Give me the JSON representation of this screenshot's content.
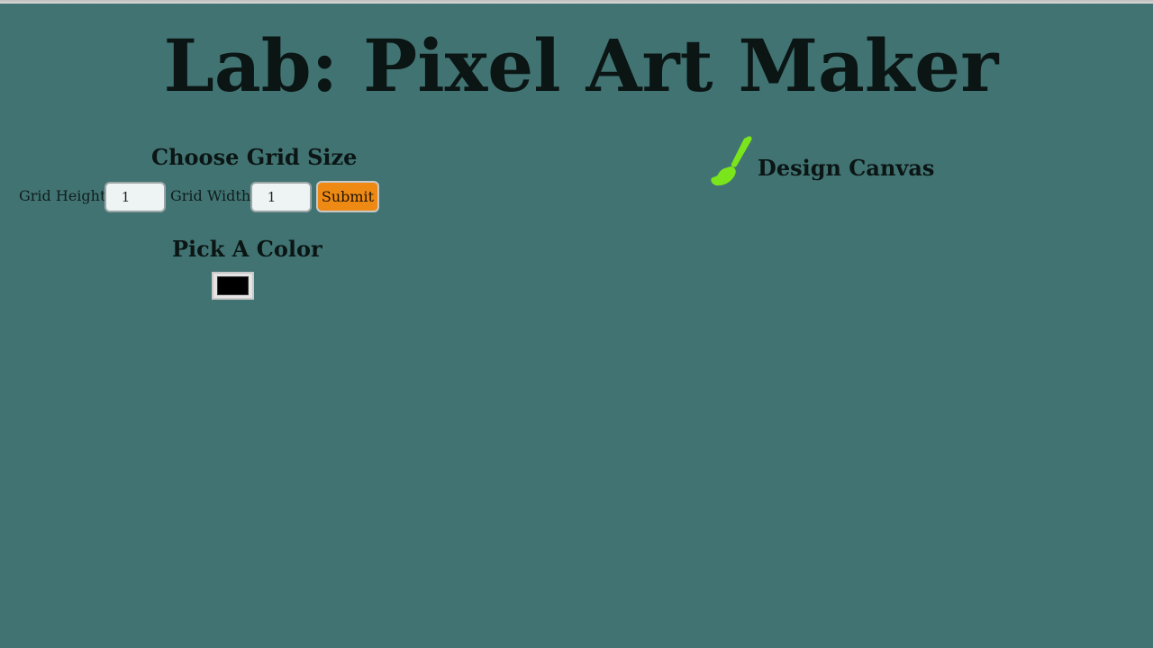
{
  "page": {
    "title": "Lab: Pixel Art Maker",
    "background_color": "#417372"
  },
  "grid_size": {
    "title": "Choose Grid Size",
    "height_label": "Grid Height:",
    "height_value": "1",
    "width_label": "Grid Width:",
    "width_value": "1",
    "submit_label": "Submit",
    "submit_color": "#ee8a14"
  },
  "color_picker": {
    "title": "Pick A Color",
    "value": "#000000"
  },
  "canvas": {
    "icon": "paint-brush-icon",
    "icon_color": "#7be51c",
    "title": "Design Canvas"
  }
}
